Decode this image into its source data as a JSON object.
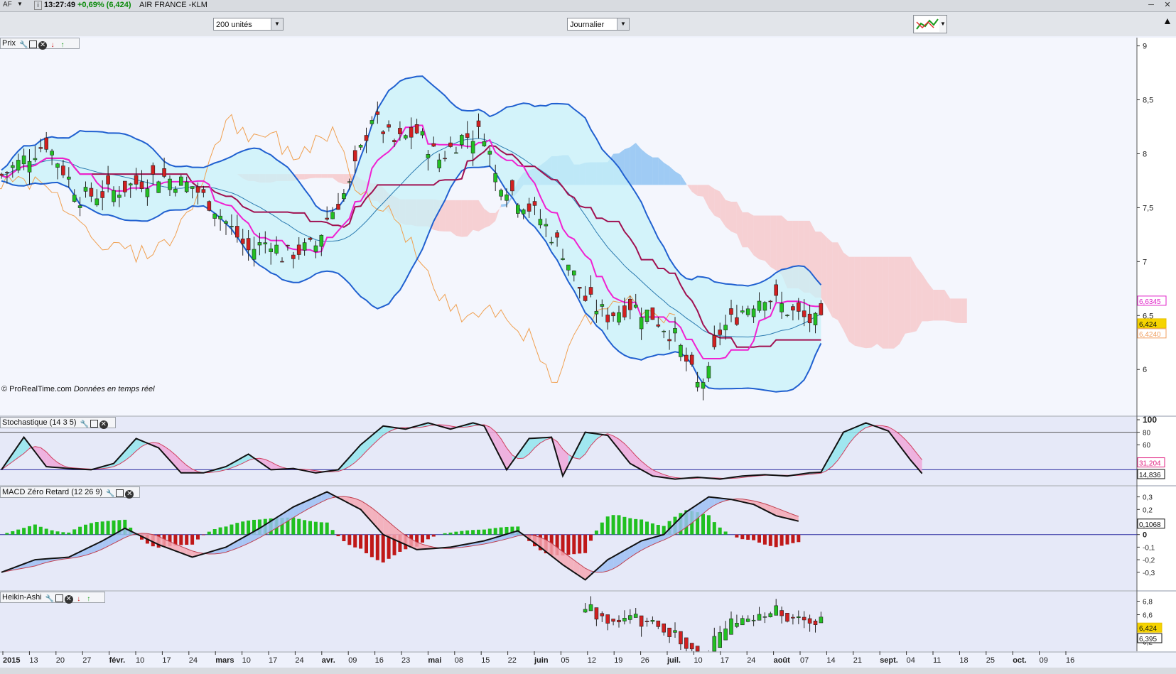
{
  "topbar": {
    "symbol": "AF",
    "info_icon_label": "i",
    "time": "13:27:49",
    "change": "+0,69% (6,424)",
    "name": "AIR FRANCE -KLM",
    "change_color": "#0a8a0a"
  },
  "toolbar": {
    "units_select": "200 unités",
    "period_select": "Journalier"
  },
  "panels": {
    "price": {
      "title": "Prix",
      "credit_source": "© ProRealTime.com",
      "credit_note": "Données en temps réel"
    },
    "stoch": {
      "title": "Stochastique (14 3 5)"
    },
    "macd": {
      "title": "MACD Zéro Retard (12 26 9)"
    },
    "heikin": {
      "title": "Heikin-Ashi"
    }
  },
  "chart_data": [
    {
      "panel": "price",
      "type": "candlestick",
      "title": "Prix",
      "ylim": [
        5.6,
        9.05
      ],
      "yticks": [
        "9",
        "8,5",
        "8",
        "7,5",
        "7",
        "6,5",
        "6"
      ],
      "last_value_labels": [
        {
          "text": "6,6345",
          "color": "#e020c8"
        },
        {
          "text": "6,424",
          "color": "#e8c000"
        },
        {
          "text": "6,4240",
          "color": "#f0a060"
        }
      ],
      "x_dates": [
        "2015",
        "13",
        "20",
        "27",
        "févr.",
        "10",
        "17",
        "24",
        "mars",
        "10",
        "17",
        "24",
        "avr.",
        "09",
        "16",
        "23",
        "mai",
        "08",
        "15",
        "22",
        "juin",
        "05",
        "12",
        "19",
        "26",
        "juil.",
        "10",
        "17",
        "24",
        "août",
        "07",
        "14",
        "21",
        "sept.",
        "04",
        "11",
        "18",
        "25",
        "oct.",
        "09",
        "16"
      ],
      "bars": 150,
      "close_path": [
        [
          0,
          7.8
        ],
        [
          8,
          8.1
        ],
        [
          14,
          7.6
        ],
        [
          20,
          7.65
        ],
        [
          28,
          7.8
        ],
        [
          34,
          7.7
        ],
        [
          38,
          7.5
        ],
        [
          44,
          7.1
        ],
        [
          48,
          7.2
        ],
        [
          50,
          7.05
        ],
        [
          56,
          7.15
        ],
        [
          58,
          7.4
        ],
        [
          62,
          7.7
        ],
        [
          66,
          8.35
        ],
        [
          70,
          8.1
        ],
        [
          74,
          8.2
        ],
        [
          78,
          7.95
        ],
        [
          82,
          8.15
        ],
        [
          86,
          8.2
        ],
        [
          88,
          7.8
        ],
        [
          92,
          7.6
        ],
        [
          96,
          7.4
        ],
        [
          100,
          7.1
        ],
        [
          104,
          6.65
        ],
        [
          108,
          6.5
        ],
        [
          112,
          6.6
        ],
        [
          116,
          6.5
        ],
        [
          120,
          6.3
        ],
        [
          124,
          5.85
        ],
        [
          126,
          5.95
        ],
        [
          128,
          6.35
        ],
        [
          132,
          6.55
        ],
        [
          136,
          6.7
        ],
        [
          140,
          6.55
        ],
        [
          144,
          6.45
        ],
        [
          146,
          6.42
        ]
      ],
      "ichimoku": {
        "senkou_a_blue_region": "jan–févr. and juin",
        "cloud_colors": {
          "bull": "#5aa8ec",
          "bear": "#f7b8b8"
        },
        "cloud_future": [
          [
            146,
            6.45,
            6.9
          ],
          [
            156,
            6.35,
            6.85
          ],
          [
            162,
            6.32,
            6.7
          ]
        ]
      },
      "indicators": [
        "Bollinger (blue)",
        "Tenkan (magenta)",
        "Kijun (maroon)",
        "Chikou (orange)"
      ]
    },
    {
      "panel": "stoch",
      "type": "line",
      "title": "Stochastique (14 3 5)",
      "ylim": [
        0,
        100
      ],
      "yticks": [
        "100",
        "80",
        "60"
      ],
      "levels": [
        80,
        20
      ],
      "last_value_labels": [
        {
          "text": "31,204",
          "color": "#e02080"
        },
        {
          "text": "14,836",
          "color": "#111111"
        }
      ],
      "k": [
        [
          0,
          20
        ],
        [
          4,
          72
        ],
        [
          8,
          25
        ],
        [
          12,
          22
        ],
        [
          16,
          20
        ],
        [
          20,
          30
        ],
        [
          24,
          70
        ],
        [
          28,
          55
        ],
        [
          32,
          15
        ],
        [
          36,
          15
        ],
        [
          40,
          25
        ],
        [
          44,
          45
        ],
        [
          48,
          20
        ],
        [
          52,
          22
        ],
        [
          56,
          15
        ],
        [
          60,
          20
        ],
        [
          64,
          60
        ],
        [
          68,
          90
        ],
        [
          72,
          85
        ],
        [
          76,
          95
        ],
        [
          80,
          85
        ],
        [
          84,
          95
        ],
        [
          86,
          90
        ],
        [
          90,
          20
        ],
        [
          94,
          70
        ],
        [
          98,
          72
        ],
        [
          100,
          10
        ],
        [
          104,
          80
        ],
        [
          108,
          75
        ],
        [
          112,
          30
        ],
        [
          116,
          10
        ],
        [
          120,
          5
        ],
        [
          124,
          8
        ],
        [
          128,
          5
        ],
        [
          132,
          10
        ],
        [
          136,
          12
        ],
        [
          140,
          10
        ],
        [
          144,
          15
        ],
        [
          146,
          16
        ],
        [
          150,
          80
        ],
        [
          154,
          95
        ],
        [
          158,
          82
        ],
        [
          162,
          35
        ],
        [
          164,
          14
        ]
      ]
    },
    {
      "panel": "macd",
      "type": "line+bar",
      "title": "MACD Zéro Retard (12 26 9)",
      "ylim": [
        -0.42,
        0.36
      ],
      "yticks": [
        "0,3",
        "0,2",
        "0,1",
        "0",
        "-0,1",
        "-0,2",
        "-0,3"
      ],
      "last_value_labels": [
        {
          "text": "0,1068",
          "color": "#111111"
        }
      ],
      "macd": [
        [
          0,
          -0.3
        ],
        [
          6,
          -0.2
        ],
        [
          12,
          -0.18
        ],
        [
          18,
          -0.05
        ],
        [
          22,
          0.05
        ],
        [
          28,
          -0.08
        ],
        [
          34,
          -0.18
        ],
        [
          40,
          -0.1
        ],
        [
          46,
          0.05
        ],
        [
          52,
          0.22
        ],
        [
          58,
          0.34
        ],
        [
          64,
          0.2
        ],
        [
          68,
          0.0
        ],
        [
          74,
          -0.12
        ],
        [
          80,
          -0.1
        ],
        [
          86,
          -0.05
        ],
        [
          92,
          0.03
        ],
        [
          96,
          -0.1
        ],
        [
          100,
          -0.24
        ],
        [
          104,
          -0.36
        ],
        [
          108,
          -0.2
        ],
        [
          114,
          -0.05
        ],
        [
          118,
          0.0
        ],
        [
          122,
          0.18
        ],
        [
          126,
          0.3
        ],
        [
          130,
          0.28
        ],
        [
          134,
          0.24
        ],
        [
          138,
          0.15
        ],
        [
          142,
          0.1068
        ]
      ],
      "histogram_colors": {
        "pos": "#20c020",
        "neg": "#c01818"
      }
    },
    {
      "panel": "heikin",
      "type": "candlestick",
      "title": "Heikin-Ashi",
      "ylim": [
        6.1,
        6.9
      ],
      "yticks": [
        "6,8",
        "6,6",
        "6,4",
        "6,2"
      ],
      "last_value_labels": [
        {
          "text": "6,424",
          "color": "#e8c000"
        },
        {
          "text": "6,395",
          "color": "#111111"
        }
      ]
    }
  ]
}
